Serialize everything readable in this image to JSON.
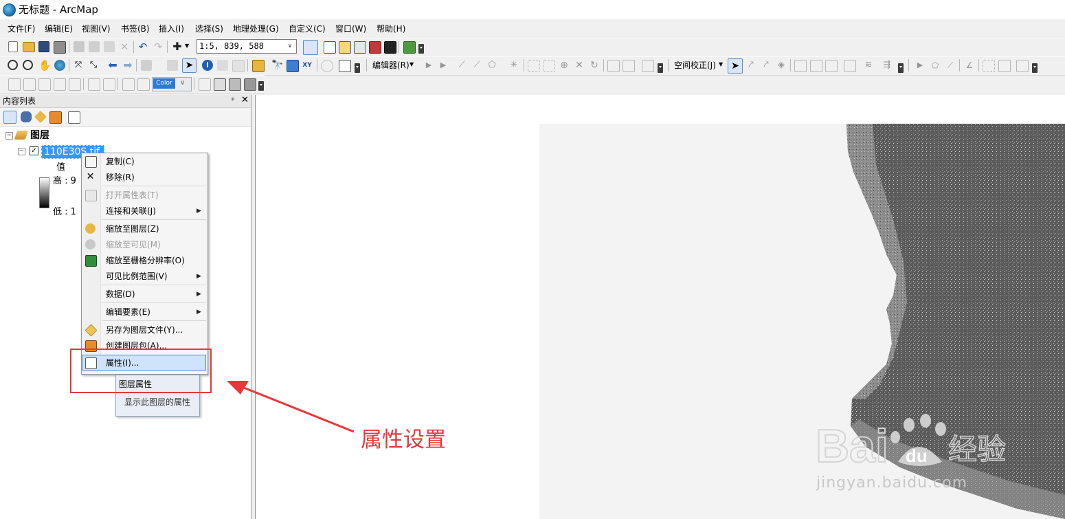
{
  "window": {
    "title": "无标题 - ArcMap",
    "app_icon": "arcmap-globe-icon"
  },
  "menubar": {
    "items": [
      "文件(F)",
      "编辑(E)",
      "视图(V)",
      "书签(B)",
      "插入(I)",
      "选择(S)",
      "地理处理(G)",
      "自定义(C)",
      "窗口(W)",
      "帮助(H)"
    ]
  },
  "toolbar": {
    "scale": "1:5, 839, 588",
    "editor_label": "编辑器(R)",
    "spatial_adjust_label": "空间校正(J)",
    "coverage_combo": "Color",
    "icons": [
      "new-document-icon",
      "open-folder-icon",
      "save-icon",
      "print-icon",
      "cut-icon",
      "copy-icon",
      "paste-icon",
      "delete-icon",
      "undo-icon",
      "redo-icon",
      "add-data-icon",
      "editor-toolbar-icon",
      "table-of-contents-icon",
      "catalog-icon",
      "search-window-icon",
      "arctoolbox-icon",
      "python-icon",
      "model-builder-icon",
      "zoom-in-icon",
      "zoom-out-icon",
      "pan-icon",
      "full-extent-icon",
      "back-icon",
      "forward-icon",
      "select-features-icon",
      "select-elements-icon",
      "identify-icon",
      "hyperlink-icon",
      "html-popup-icon",
      "measure-icon",
      "find-icon",
      "go-to-xy-icon",
      "time-slider-icon",
      "viewer-window-icon"
    ]
  },
  "toc": {
    "title": "内容列表",
    "pin_glyph": "ᵖ",
    "close_glyph": "✕",
    "view_icons": [
      "list-by-drawing-order-icon",
      "list-by-source-icon",
      "list-by-visibility-icon",
      "list-by-selection-icon",
      "options-icon"
    ],
    "root_label": "图层",
    "layer": {
      "name": "110E30S.tif",
      "checked": true,
      "legend_heading": "值",
      "high_label": "高 : 9",
      "low_label": "低 : 1"
    }
  },
  "context_menu": {
    "items": [
      {
        "label": "复制(C)",
        "icon": "copy-icon",
        "enabled": true,
        "submenu": false
      },
      {
        "label": "移除(R)",
        "icon": "remove-x-icon",
        "enabled": true,
        "submenu": false
      },
      {
        "label": "打开属性表(T)",
        "icon": "attribute-table-icon",
        "enabled": false,
        "submenu": false
      },
      {
        "label": "连接和关联(J)",
        "icon": "",
        "enabled": true,
        "submenu": true
      },
      {
        "label": "缩放至图层(Z)",
        "icon": "zoom-to-layer-icon",
        "enabled": true,
        "submenu": false
      },
      {
        "label": "缩放至可见(M)",
        "icon": "zoom-to-visible-icon",
        "enabled": false,
        "submenu": false
      },
      {
        "label": "缩放至栅格分辨率(O)",
        "icon": "zoom-raster-resolution-icon",
        "enabled": true,
        "submenu": false
      },
      {
        "label": "可见比例范围(V)",
        "icon": "",
        "enabled": true,
        "submenu": true
      },
      {
        "label": "数据(D)",
        "icon": "",
        "enabled": true,
        "submenu": true
      },
      {
        "label": "编辑要素(E)",
        "icon": "",
        "enabled": true,
        "submenu": true
      },
      {
        "label": "另存为图层文件(Y)...",
        "icon": "layer-file-icon",
        "enabled": true,
        "submenu": false
      },
      {
        "label": "创建图层包(A)...",
        "icon": "layer-package-icon",
        "enabled": true,
        "submenu": false
      },
      {
        "label": "属性(I)...",
        "icon": "properties-icon",
        "enabled": true,
        "submenu": false,
        "highlighted": true
      }
    ],
    "submenu_glyph": "▶"
  },
  "tooltip": {
    "title": "图层属性",
    "description": "显示此图层的属性"
  },
  "annotation": {
    "text": "属性设置",
    "color": "#e8373a"
  },
  "watermark": {
    "brand": "Bai",
    "brand_du": "du",
    "brand_cn": "经验",
    "url": "jingyan.baidu.com"
  },
  "colors": {
    "selection_blue": "#3399ff",
    "menu_highlight": "#cfe3fa",
    "annotation_red": "#e8373a"
  }
}
